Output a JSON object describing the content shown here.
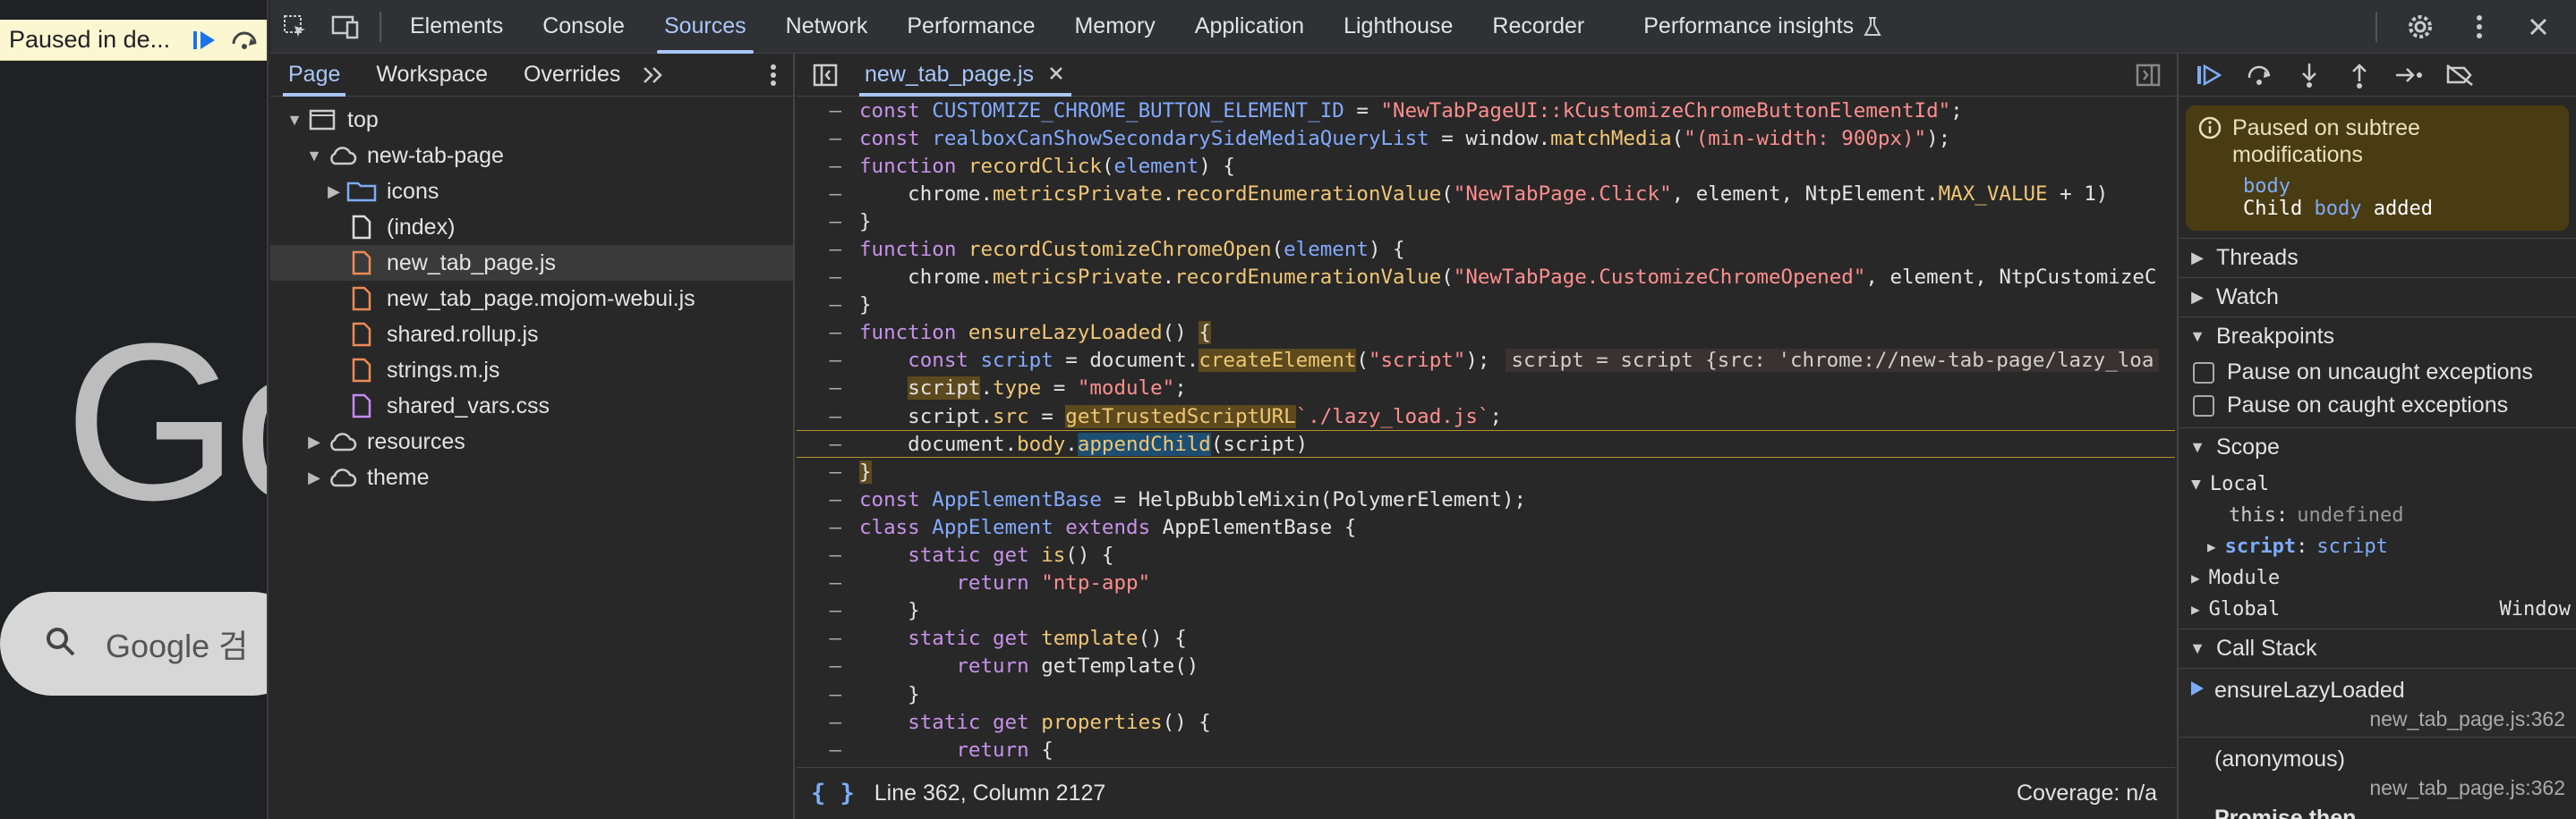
{
  "preview": {
    "paused_text": "Paused in de...",
    "logo_text": "Go",
    "search_placeholder": "Google 검"
  },
  "toolbar": {
    "tabs": [
      "Elements",
      "Console",
      "Sources",
      "Network",
      "Performance",
      "Memory",
      "Application",
      "Lighthouse",
      "Recorder",
      "Performance insights"
    ],
    "active_tab": "Sources"
  },
  "navigator": {
    "tabs": [
      "Page",
      "Workspace",
      "Overrides"
    ],
    "active_tab": "Page",
    "tree": [
      {
        "label": "top",
        "depth": 0,
        "icon": "frame-icon",
        "expanded": true
      },
      {
        "label": "new-tab-page",
        "depth": 1,
        "icon": "cloud-icon",
        "expanded": true
      },
      {
        "label": "icons",
        "depth": 2,
        "icon": "folder-icon",
        "expanded": false
      },
      {
        "label": "(index)",
        "depth": 2,
        "icon": "document-icon"
      },
      {
        "label": "new_tab_page.js",
        "depth": 2,
        "icon": "js-file-icon",
        "selected": true
      },
      {
        "label": "new_tab_page.mojom-webui.js",
        "depth": 2,
        "icon": "js-file-icon"
      },
      {
        "label": "shared.rollup.js",
        "depth": 2,
        "icon": "js-file-icon"
      },
      {
        "label": "strings.m.js",
        "depth": 2,
        "icon": "js-file-icon"
      },
      {
        "label": "shared_vars.css",
        "depth": 2,
        "icon": "css-file-icon"
      },
      {
        "label": "resources",
        "depth": 1,
        "icon": "cloud-icon",
        "expanded": false
      },
      {
        "label": "theme",
        "depth": 1,
        "icon": "cloud-icon",
        "expanded": false
      }
    ]
  },
  "editor": {
    "file_tab": "new_tab_page.js",
    "gutter_mark": "–",
    "status_position": "Line 362, Column 2127",
    "coverage": "Coverage: n/a"
  },
  "debugger": {
    "pause_title": "Paused on subtree modifications",
    "pause_node": "body",
    "pause_detail": [
      "Child ",
      "body",
      " added"
    ],
    "threads": "Threads",
    "watch": "Watch",
    "breakpoints": "Breakpoints",
    "uncaught": "Pause on uncaught exceptions",
    "caught": "Pause on caught exceptions",
    "scope": "Scope",
    "local": "Local",
    "this_key": "this",
    "this_val": "undefined",
    "script_key": "script",
    "script_val": "script",
    "module": "Module",
    "global": "Global",
    "global_val": "Window",
    "call_stack": "Call Stack",
    "frames": [
      {
        "name": "ensureLazyLoaded",
        "loc": "new_tab_page.js:362",
        "active": true
      },
      {
        "name": "(anonymous)",
        "loc": "new_tab_page.js:362"
      },
      {
        "name": "Promise.then",
        "loc": ""
      }
    ]
  }
}
